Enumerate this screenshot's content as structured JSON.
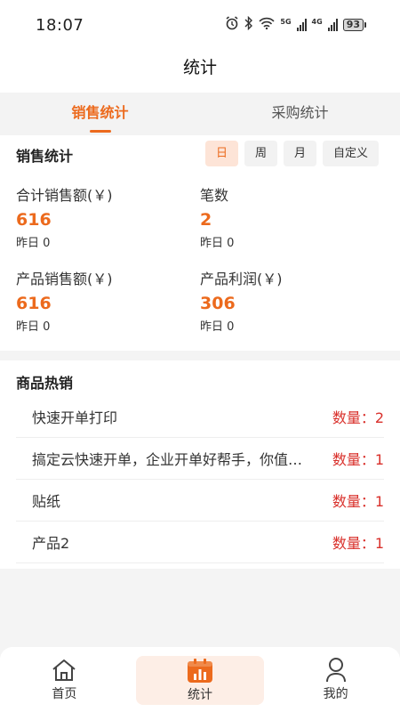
{
  "status_bar": {
    "time": "18:07",
    "net1": "5G",
    "net2": "4G",
    "battery": "93"
  },
  "header": {
    "title": "统计"
  },
  "tabs": [
    {
      "label": "销售统计"
    },
    {
      "label": "采购统计"
    }
  ],
  "sales": {
    "title": "销售统计",
    "periods": [
      "日",
      "周",
      "月",
      "自定义"
    ],
    "stats": [
      {
        "label": "合计销售额(￥)",
        "value": "616",
        "yesterday": "昨日 0"
      },
      {
        "label": "笔数",
        "value": "2",
        "yesterday": "昨日 0"
      },
      {
        "label": "产品销售额(￥)",
        "value": "616",
        "yesterday": "昨日 0"
      },
      {
        "label": "产品利润(￥)",
        "value": "306",
        "yesterday": "昨日 0"
      }
    ]
  },
  "hot": {
    "title": "商品热销",
    "items": [
      {
        "name": "快速开单打印",
        "qty": "数量：2"
      },
      {
        "name": "搞定云快速开单，企业开单好帮手，你值得拥有",
        "qty": "数量：1"
      },
      {
        "name": "贴纸",
        "qty": "数量：1"
      },
      {
        "name": "产品2",
        "qty": "数量：1"
      }
    ]
  },
  "bottom_nav": [
    {
      "label": "首页"
    },
    {
      "label": "统计"
    },
    {
      "label": "我的"
    }
  ],
  "colors": {
    "accent": "#ec6a1d",
    "qty": "#d9302b"
  }
}
